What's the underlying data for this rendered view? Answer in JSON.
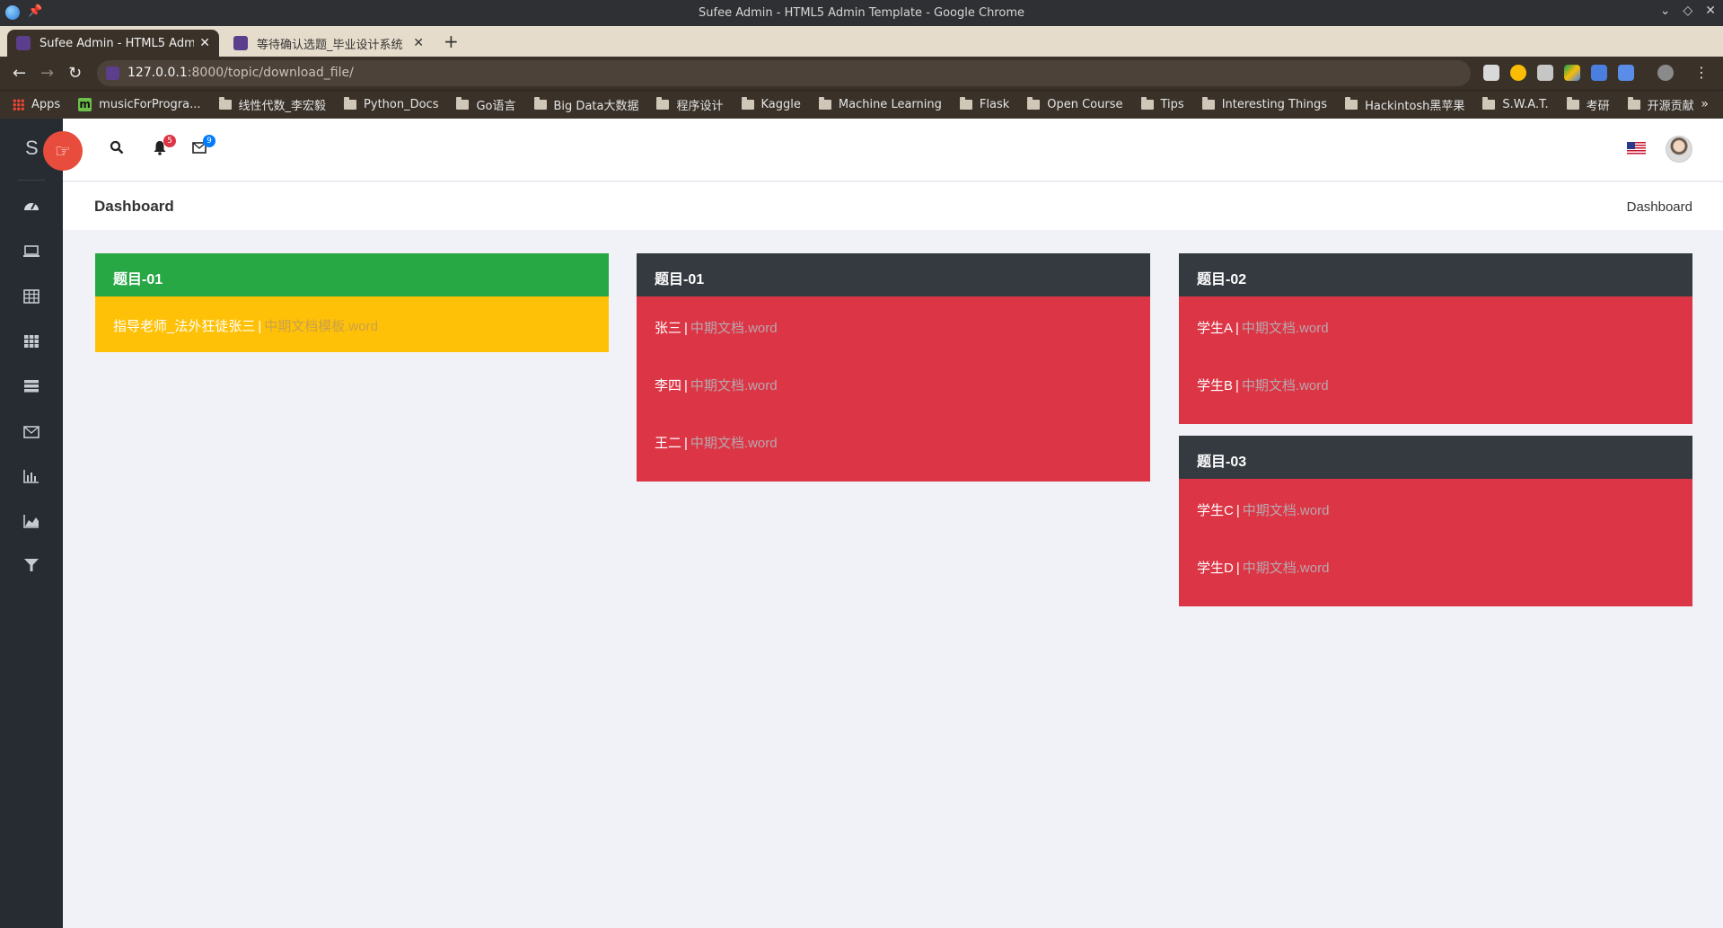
{
  "window": {
    "title": "Sufee Admin - HTML5 Admin Template - Google Chrome",
    "controls": [
      "chevron-down-icon",
      "restore-icon",
      "close-icon"
    ]
  },
  "tabs": [
    {
      "label": "Sufee Admin - HTML5 Admin",
      "active": true
    },
    {
      "label": "等待确认选题_毕业设计系统",
      "active": false
    }
  ],
  "address": {
    "host": "127.0.0.1",
    "rest": ":8000/topic/download_file/"
  },
  "bookmarks": [
    {
      "label": "Apps",
      "icon": "apps-grid-icon"
    },
    {
      "label": "musicForProgra...",
      "icon": "music-icon"
    },
    {
      "label": "线性代数_李宏毅",
      "icon": "folder-icon"
    },
    {
      "label": "Python_Docs",
      "icon": "folder-icon"
    },
    {
      "label": "Go语言",
      "icon": "folder-icon"
    },
    {
      "label": "Big Data大数据",
      "icon": "folder-icon"
    },
    {
      "label": "程序设计",
      "icon": "folder-icon"
    },
    {
      "label": "Kaggle",
      "icon": "folder-icon"
    },
    {
      "label": "Machine Learning",
      "icon": "folder-icon"
    },
    {
      "label": "Flask",
      "icon": "folder-icon"
    },
    {
      "label": "Open Course",
      "icon": "folder-icon"
    },
    {
      "label": "Tips",
      "icon": "folder-icon"
    },
    {
      "label": "Interesting Things",
      "icon": "folder-icon"
    },
    {
      "label": "Hackintosh黑苹果",
      "icon": "folder-icon"
    },
    {
      "label": "S.W.A.T.",
      "icon": "folder-icon"
    },
    {
      "label": "考研",
      "icon": "folder-icon"
    },
    {
      "label": "开源贡献",
      "icon": "folder-icon"
    }
  ],
  "sidebar": {
    "brand_letter": "S",
    "items": [
      "dashboard-icon",
      "laptop-icon",
      "table-icon",
      "grid-icon",
      "list-icon",
      "envelope-icon",
      "bar-chart-icon",
      "area-chart-icon",
      "filter-icon"
    ]
  },
  "header": {
    "notifications_count": "5",
    "messages_count": "9"
  },
  "breadcrumb": {
    "title": "Dashboard",
    "current": "Dashboard"
  },
  "cards": [
    {
      "title": "题目-01",
      "rows": [
        {
          "name": "指导老师_法外狂徒张三",
          "file": "中期文档模板.word"
        }
      ]
    },
    {
      "title": "题目-01",
      "rows": [
        {
          "name": "张三",
          "file": "中期文档.word"
        },
        {
          "name": "李四",
          "file": "中期文档.word"
        },
        {
          "name": "王二",
          "file": "中期文档.word"
        }
      ]
    },
    {
      "title": "题目-02",
      "rows": [
        {
          "name": "学生A",
          "file": "中期文档.word"
        },
        {
          "name": "学生B",
          "file": "中期文档.word"
        }
      ]
    },
    {
      "title": "题目-03",
      "rows": [
        {
          "name": "学生C",
          "file": "中期文档.word"
        },
        {
          "name": "学生D",
          "file": "中期文档.word"
        }
      ]
    }
  ],
  "colors": {
    "card_head_green": "#28a745",
    "card_body_yellow": "#ffc107",
    "card_head_dark": "#343a40",
    "card_body_red": "#dc3545",
    "sidebar_bg": "#272c33",
    "brand_button": "#e74c3c",
    "badge_red": "#dc3545",
    "badge_blue": "#007bff"
  }
}
